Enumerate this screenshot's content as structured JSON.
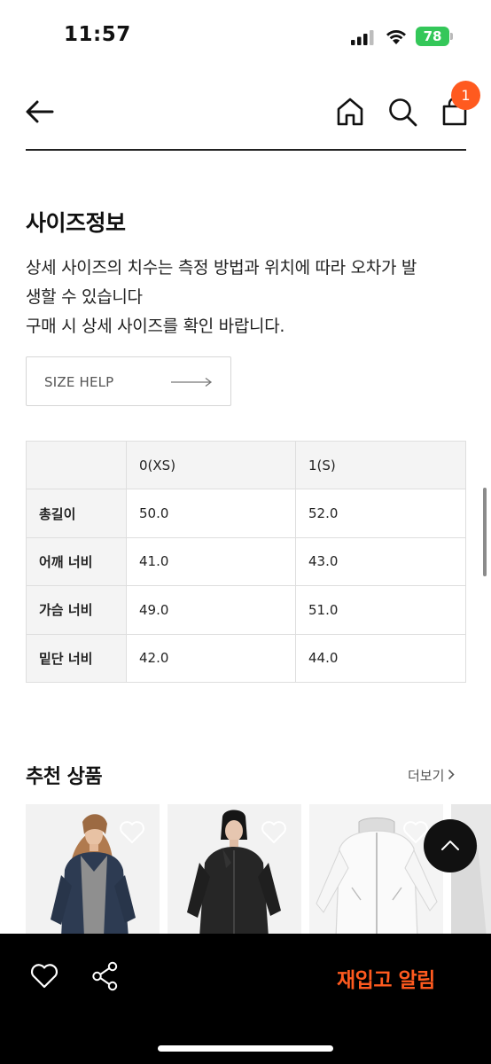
{
  "status_bar": {
    "time": "11:57",
    "battery": "78"
  },
  "nav": {
    "cart_count": "1",
    "icons": [
      "back-arrow-icon",
      "home-icon",
      "search-icon",
      "shopping-bag-icon"
    ]
  },
  "size_info": {
    "title": "사이즈정보",
    "description_lines": [
      "상세 사이즈의 치수는 측정 방법과 위치에 따라 오차가 발",
      "생할 수 있습니다",
      "구매 시 상세 사이즈를 확인 바랍니다."
    ],
    "help_button": "SIZE HELP"
  },
  "size_table": {
    "headers": [
      "",
      "0(XS)",
      "1(S)"
    ],
    "rows": [
      {
        "label": "총길이",
        "values": [
          "50.0",
          "52.0"
        ]
      },
      {
        "label": "어깨 너비",
        "values": [
          "41.0",
          "43.0"
        ]
      },
      {
        "label": "가슴 너비",
        "values": [
          "49.0",
          "51.0"
        ]
      },
      {
        "label": "밑단 너비",
        "values": [
          "42.0",
          "44.0"
        ]
      }
    ]
  },
  "recommend": {
    "title": "추천 상품",
    "more": "더보기"
  },
  "bottom_bar": {
    "restock": "재입고 알림"
  },
  "colors": {
    "accent": "#ff5a1f",
    "bottom_bar": "#000000",
    "battery": "#34c759"
  }
}
